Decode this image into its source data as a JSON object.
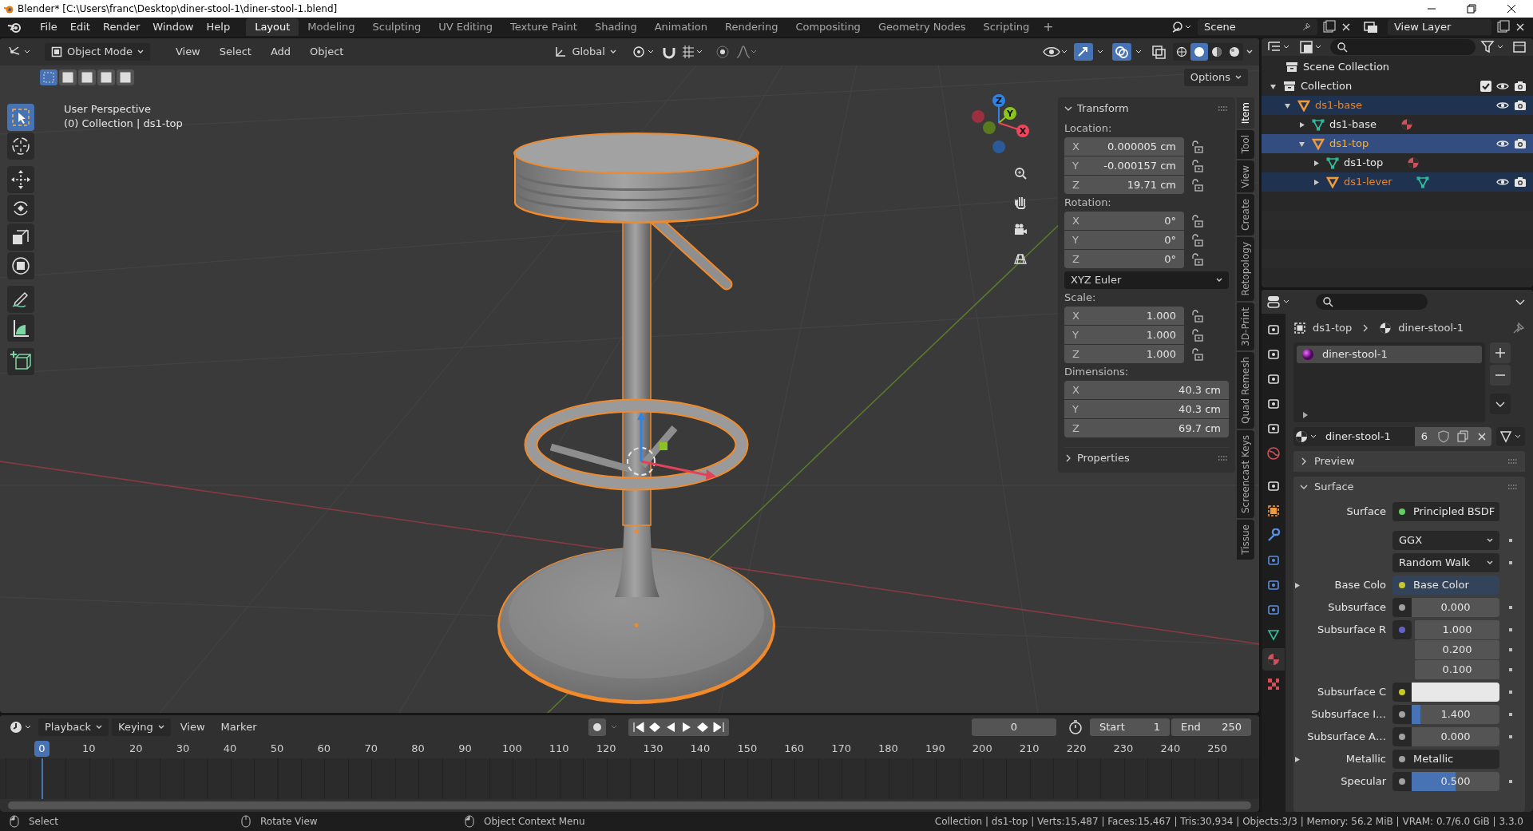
{
  "window": {
    "title": "Blender* [C:\\Users\\franc\\Desktop\\diner-stool-1\\diner-stool-1.blend]"
  },
  "menu": [
    "File",
    "Edit",
    "Render",
    "Window",
    "Help"
  ],
  "workspaces": [
    {
      "label": "Layout",
      "selected": true
    },
    {
      "label": "Modeling",
      "selected": false
    },
    {
      "label": "Sculpting",
      "selected": false
    },
    {
      "label": "UV Editing",
      "selected": false
    },
    {
      "label": "Texture Paint",
      "selected": false
    },
    {
      "label": "Shading",
      "selected": false
    },
    {
      "label": "Animation",
      "selected": false
    },
    {
      "label": "Rendering",
      "selected": false
    },
    {
      "label": "Compositing",
      "selected": false
    },
    {
      "label": "Geometry Nodes",
      "selected": false
    },
    {
      "label": "Scripting",
      "selected": false
    }
  ],
  "add_workspace": "+",
  "scene": "Scene",
  "view_layer": "View Layer",
  "viewport": {
    "mode": "Object Mode",
    "menus": [
      "View",
      "Select",
      "Add",
      "Object"
    ],
    "orientation": "Global",
    "options": "Options",
    "select_modes": [
      {
        "selected": true
      },
      {
        "selected": false
      },
      {
        "selected": false
      },
      {
        "selected": false
      },
      {
        "selected": false
      }
    ],
    "shading": [
      {
        "selected": false
      },
      {
        "selected": true
      },
      {
        "selected": false
      },
      {
        "selected": false
      }
    ],
    "tools": [
      {
        "selected": true
      },
      {
        "selected": false
      },
      {
        "selected": false
      },
      {
        "selected": false
      },
      {
        "selected": false
      },
      {
        "selected": false
      },
      {
        "selected": false
      },
      {
        "selected": false
      },
      {
        "selected": false
      }
    ],
    "view_name": "User Perspective",
    "context": "(0) Collection | ds1-top",
    "gizmo_axes": [
      {
        "label": "Z",
        "color": "#2f83e8"
      },
      {
        "label": "Y",
        "color": "#8bc421"
      },
      {
        "label": "X",
        "color": "#f0455a"
      }
    ]
  },
  "sidebar": {
    "tabs": [
      {
        "label": "Item",
        "selected": true
      },
      {
        "label": "Tool",
        "selected": false
      },
      {
        "label": "View",
        "selected": false
      },
      {
        "label": "Create",
        "selected": false
      },
      {
        "label": "Retopology",
        "selected": false
      },
      {
        "label": "3D-Print",
        "selected": false
      },
      {
        "label": "Quad Remesh",
        "selected": false
      },
      {
        "label": "Screencast Keys",
        "selected": false
      },
      {
        "label": "Tissue",
        "selected": false
      }
    ],
    "transform": {
      "title": "Transform",
      "expanded": true,
      "groups": [
        {
          "label": "Location:",
          "rows": [
            {
              "axis": "X",
              "value": "0.000005 cm",
              "locked": false
            },
            {
              "axis": "Y",
              "value": "-0.000157 cm",
              "locked": false
            },
            {
              "axis": "Z",
              "value": "19.71 cm",
              "locked": false
            }
          ]
        },
        {
          "label": "Rotation:",
          "rows": [
            {
              "axis": "X",
              "value": "0°",
              "locked": false
            },
            {
              "axis": "Y",
              "value": "0°",
              "locked": false
            },
            {
              "axis": "Z",
              "value": "0°",
              "locked": false
            }
          ],
          "mode": "XYZ Euler"
        },
        {
          "label": "Scale:",
          "rows": [
            {
              "axis": "X",
              "value": "1.000",
              "locked": false
            },
            {
              "axis": "Y",
              "value": "1.000",
              "locked": false
            },
            {
              "axis": "Z",
              "value": "1.000",
              "locked": false
            }
          ]
        },
        {
          "label": "Dimensions:",
          "rows": [
            {
              "axis": "X",
              "value": "40.3 cm"
            },
            {
              "axis": "Y",
              "value": "40.3 cm"
            },
            {
              "axis": "Z",
              "value": "69.7 cm"
            }
          ]
        }
      ]
    },
    "properties": {
      "title": "Properties",
      "expanded": false
    }
  },
  "outliner": {
    "root": "Scene Collection",
    "items": [
      {
        "label": "Collection",
        "kind": "collection",
        "selected": false,
        "active": false,
        "expanded": true,
        "checked": true,
        "children": [
          {
            "label": "ds1-base",
            "kind": "object",
            "selected": true,
            "active": false,
            "expanded": true,
            "children": [
              {
                "label": "ds1-base",
                "kind": "mesh",
                "selected": false,
                "active": false,
                "expanded": false
              },
              {
                "label": "ds1-top",
                "kind": "object",
                "selected": true,
                "active": true,
                "expanded": true,
                "children": [
                  {
                    "label": "ds1-top",
                    "kind": "mesh",
                    "selected": false,
                    "active": false,
                    "expanded": false
                  },
                  {
                    "label": "ds1-lever",
                    "kind": "object",
                    "selected": true,
                    "active": false,
                    "expanded": false
                  }
                ]
              }
            ]
          }
        ]
      }
    ]
  },
  "properties": {
    "tabs": [
      {
        "selected": false
      },
      {
        "selected": false
      },
      {
        "selected": false
      },
      {
        "selected": false
      },
      {
        "selected": false
      },
      {
        "selected": false
      },
      {
        "selected": false
      },
      {
        "selected": false
      },
      {
        "selected": false
      },
      {
        "selected": false
      },
      {
        "selected": false
      },
      {
        "selected": false
      },
      {
        "selected": false
      },
      {
        "selected": true
      },
      {
        "selected": false
      }
    ],
    "breadcrumb": [
      "ds1-top",
      "diner-stool-1"
    ],
    "slots": [
      {
        "label": "diner-stool-1",
        "selected": true
      }
    ],
    "material": {
      "name": "diner-stool-1",
      "users": "6"
    },
    "panels": [
      {
        "title": "Preview",
        "expanded": false
      },
      {
        "title": "Surface",
        "expanded": true
      }
    ],
    "fields": [
      {
        "kind": "link",
        "label": "Surface",
        "value": "Principled BSDF",
        "color": "#5fcf5f"
      },
      {
        "kind": "dropdown",
        "value": "GGX"
      },
      {
        "kind": "dropdown",
        "value": "Random Walk"
      },
      {
        "kind": "input",
        "label": "Base Colo",
        "value": "Base Color",
        "color": "#c7c729",
        "expanded": false
      },
      {
        "kind": "number",
        "label": "Subsurface",
        "value": "0.000",
        "color": "#a1a1a1"
      },
      {
        "kind": "vector",
        "label": "Subsurface R",
        "values": [
          "1.000",
          "0.200",
          "0.100"
        ],
        "color": "#6363c7"
      },
      {
        "kind": "swatch",
        "label": "Subsurface C",
        "color": "#c7c729"
      },
      {
        "kind": "slider",
        "label": "Subsurface I…",
        "value": "1.400",
        "color": "#a1a1a1",
        "level": 0.1
      },
      {
        "kind": "number",
        "label": "Subsurface A…",
        "value": "0.000",
        "color": "#a1a1a1"
      },
      {
        "kind": "link",
        "label": "Metallic",
        "value": "Metallic",
        "color": "#a1a1a1",
        "expanded": false
      },
      {
        "kind": "slider",
        "label": "Specular",
        "value": "0.500",
        "color": "#a1a1a1",
        "level": 0.5
      }
    ]
  },
  "timeline": {
    "menus": [
      "Playback",
      "Keying",
      "View",
      "Marker"
    ],
    "current_frame": "0",
    "start_label": "Start",
    "start": "1",
    "end_label": "End",
    "end": "250",
    "ruler": [
      {
        "label": "0",
        "selected": true
      },
      {
        "label": "10",
        "selected": false
      },
      {
        "label": "20",
        "selected": false
      },
      {
        "label": "30",
        "selected": false
      },
      {
        "label": "40",
        "selected": false
      },
      {
        "label": "50",
        "selected": false
      },
      {
        "label": "60",
        "selected": false
      },
      {
        "label": "70",
        "selected": false
      },
      {
        "label": "80",
        "selected": false
      },
      {
        "label": "90",
        "selected": false
      },
      {
        "label": "100",
        "selected": false
      },
      {
        "label": "110",
        "selected": false
      },
      {
        "label": "120",
        "selected": false
      },
      {
        "label": "130",
        "selected": false
      },
      {
        "label": "140",
        "selected": false
      },
      {
        "label": "150",
        "selected": false
      },
      {
        "label": "160",
        "selected": false
      },
      {
        "label": "170",
        "selected": false
      },
      {
        "label": "180",
        "selected": false
      },
      {
        "label": "190",
        "selected": false
      },
      {
        "label": "200",
        "selected": false
      },
      {
        "label": "210",
        "selected": false
      },
      {
        "label": "220",
        "selected": false
      },
      {
        "label": "230",
        "selected": false
      },
      {
        "label": "240",
        "selected": false
      },
      {
        "label": "250",
        "selected": false
      }
    ]
  },
  "status_bar": {
    "hints": [
      "Select",
      "Rotate View",
      "Object Context Menu"
    ],
    "stats": "Collection | ds1-top | Verts:15,487 | Faces:15,467 | Tris:30,934 | Objects:3/3 | Memory: 56.2 MiB | VRAM: 0.7/6.0 GiB | 3.3.0"
  }
}
